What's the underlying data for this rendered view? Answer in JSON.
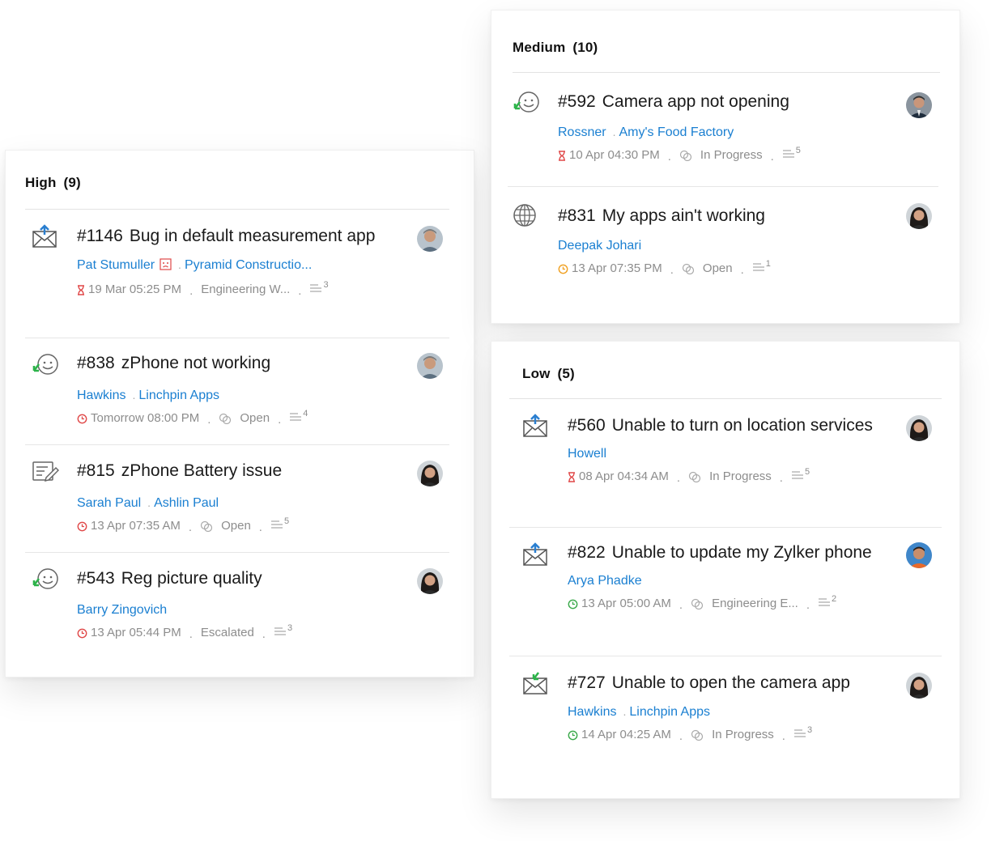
{
  "panels": {
    "high": {
      "label": "High",
      "count": "(9)",
      "tickets": [
        {
          "icon": "mail-icon",
          "number": "#1146",
          "title": "Bug in default measurement app",
          "contact": "Pat Stumuller",
          "account": "Pyramid Constructio...",
          "due": "19 Mar 05:25 PM",
          "due_color": "#e04848",
          "status": "Engineering W...",
          "threads": "3"
        },
        {
          "icon": "happy-face-icon",
          "number": "#838",
          "title": "zPhone not working",
          "contact": "Hawkins",
          "account": "Linchpin Apps",
          "due": "Tomorrow 08:00 PM",
          "due_color": "#e04848",
          "status": "Open",
          "threads": "4"
        },
        {
          "icon": "form-edit-icon",
          "number": "#815",
          "title": "zPhone Battery issue",
          "contact": "Sarah Paul",
          "account": "Ashlin Paul",
          "due": "13 Apr 07:35 AM",
          "due_color": "#e04848",
          "status": "Open",
          "threads": "5"
        },
        {
          "icon": "happy-face-icon",
          "number": "#543",
          "title": "Reg picture quality",
          "contact": "Barry Zingovich",
          "account": "",
          "due": "13 Apr 05:44 PM",
          "due_color": "#e04848",
          "status": "Escalated",
          "threads": "3"
        }
      ]
    },
    "medium": {
      "label": "Medium",
      "count": "(10)",
      "tickets": [
        {
          "icon": "happy-face-icon",
          "number": "#592",
          "title": "Camera app not opening",
          "contact": "Rossner",
          "account": "Amy's Food Factory",
          "due": "10 Apr 04:30 PM",
          "due_color": "#e04848",
          "status": "In Progress",
          "threads": "5"
        },
        {
          "icon": "globe-icon",
          "number": "#831",
          "title": "My apps ain't working",
          "contact": "Deepak Johari",
          "account": "",
          "due": "13 Apr 07:35 PM",
          "due_color": "#f0a020",
          "status": "Open",
          "threads": "1"
        }
      ]
    },
    "low": {
      "label": "Low",
      "count": "(5)",
      "tickets": [
        {
          "icon": "mail-icon",
          "number": "#560",
          "title": "Unable to turn on location services",
          "contact": "Howell",
          "account": "",
          "due": "08 Apr 04:34 AM",
          "due_color": "#e04848",
          "status": "In Progress",
          "threads": "5"
        },
        {
          "icon": "mail-icon",
          "number": "#822",
          "title": "Unable to update my Zylker phone",
          "contact": "Arya Phadke",
          "account": "",
          "due": "13 Apr 05:00 AM",
          "due_color": "#3aa94a",
          "status": "Engineering E...",
          "threads": "2"
        },
        {
          "icon": "mail-green-icon",
          "number": "#727",
          "title": "Unable to open the camera app",
          "contact": "Hawkins",
          "account": "Linchpin Apps",
          "due": "14 Apr 04:25 AM",
          "due_color": "#3aa94a",
          "status": "In Progress",
          "threads": "3"
        }
      ]
    }
  },
  "colors": {
    "link": "#1a7fd1",
    "meta": "#8d8d8d",
    "overdue": "#e04848",
    "warning": "#f0a020",
    "ok": "#3aa94a"
  }
}
